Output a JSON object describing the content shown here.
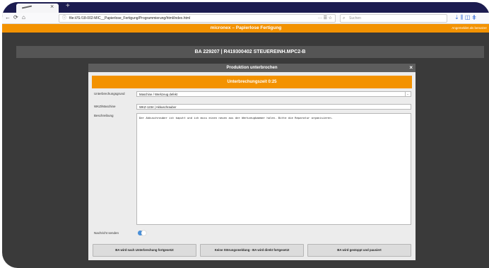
{
  "browser": {
    "tab_close": "×",
    "new_tab": "+",
    "url": "file:///S:/18-002-MIC__Papierlose_Fertigung/Programmierung/html/index.html",
    "url_actions": "··· ☰ ☆",
    "search_placeholder": "Suchen",
    "toolbar_icons": "⇣ ⫼ ◫ ⋕"
  },
  "app": {
    "title": "micronex – Papierlose Fertigung",
    "user_info": "Angemeldet als benutzer"
  },
  "order": {
    "title": "BA 229207 | R419300402 STEUEREINH.MPC2-B"
  },
  "modal": {
    "title": "Produktion unterbrochen",
    "close": "×",
    "timer": "Unterbrechungszeit 0:25",
    "fields": {
      "reason_label": "Unterbrechungsgrund",
      "reason_value": "Maschine / Werkzeug defekt",
      "tool_label": "WKZ/Maschine",
      "tool_value": "WKZ-1234 | Akkuschrauber",
      "description_label": "Beschreibung",
      "description_value": "Der Akkuschrauber ist kaputt und ich muss einen neuen aus der Werkzeugkammer holen. Bitte die Reparatur organisieren."
    },
    "notify_label": "Nachricht senden",
    "notify_on": true,
    "buttons": {
      "continue_after": "BA wird nach Unterbrechung fortgesetzt",
      "no_fault": "Keine Störungsmeldung - BA wird direkt fortgesetzt",
      "stopped": "BA wird gestoppt und pausiert"
    }
  }
}
